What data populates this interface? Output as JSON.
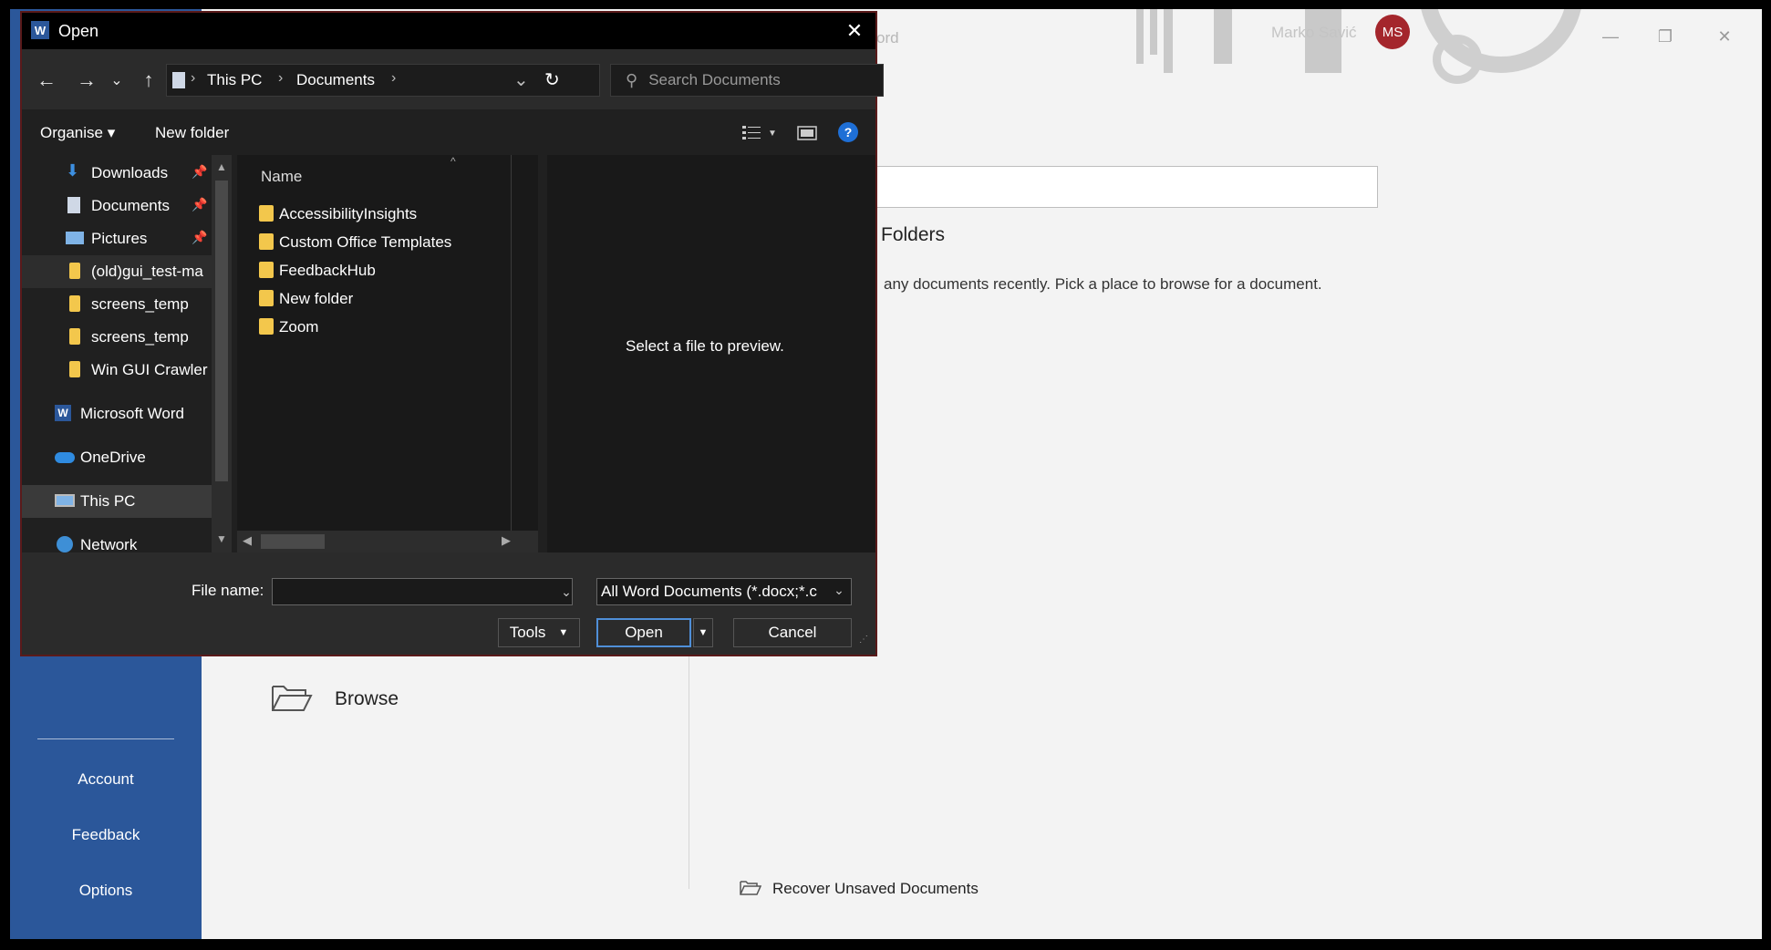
{
  "word": {
    "title_fragment": "ord",
    "user_name": "Marko Savić",
    "avatar_initials": "MS",
    "folders_heading": "Folders",
    "empty_message": "any documents recently. Pick a place to browse for a document.",
    "browse_label": "Browse",
    "recover_label": "Recover Unsaved Documents",
    "left_nav": {
      "account": "Account",
      "feedback": "Feedback",
      "options": "Options"
    },
    "accent_color": "#2b579a"
  },
  "dialog": {
    "title": "Open",
    "close_glyph": "✕",
    "nav": {
      "back": "←",
      "forward": "→",
      "recent": "⌄",
      "up": "↑"
    },
    "address": {
      "segments": [
        "This PC",
        "Documents"
      ],
      "separator": "›",
      "dropdown": "⌄",
      "refresh": "↻"
    },
    "search_placeholder": "Search Documents",
    "toolbar": {
      "organise": "Organise ▾",
      "new_folder": "New folder",
      "help": "?"
    },
    "nav_pane": [
      {
        "label": "Downloads",
        "icon": "download-icon",
        "pinned": true
      },
      {
        "label": "Documents",
        "icon": "documents-icon",
        "pinned": true
      },
      {
        "label": "Pictures",
        "icon": "pictures-icon",
        "pinned": true
      },
      {
        "label": "(old)gui_test-ma",
        "icon": "folder-icon",
        "pinned": false
      },
      {
        "label": "screens_temp",
        "icon": "folder-icon",
        "pinned": false
      },
      {
        "label": "screens_temp",
        "icon": "folder-icon",
        "pinned": false
      },
      {
        "label": "Win GUI Crawler",
        "icon": "folder-icon",
        "pinned": false
      },
      {
        "label": "Microsoft Word",
        "icon": "word-icon",
        "pinned": false
      },
      {
        "label": "OneDrive",
        "icon": "onedrive-icon",
        "pinned": false
      },
      {
        "label": "This PC",
        "icon": "computer-icon",
        "pinned": false,
        "selected": true
      },
      {
        "label": "Network",
        "icon": "network-icon",
        "pinned": false
      }
    ],
    "file_list": {
      "column_name": "Name",
      "items": [
        "AccessibilityInsights",
        "Custom Office Templates",
        "FeedbackHub",
        "New folder",
        "Zoom"
      ]
    },
    "preview_text": "Select a file to preview.",
    "footer": {
      "file_name_label": "File name:",
      "file_name_value": "",
      "filter": "All Word Documents (*.docx;*.c",
      "tools": "Tools",
      "open": "Open",
      "cancel": "Cancel"
    }
  }
}
